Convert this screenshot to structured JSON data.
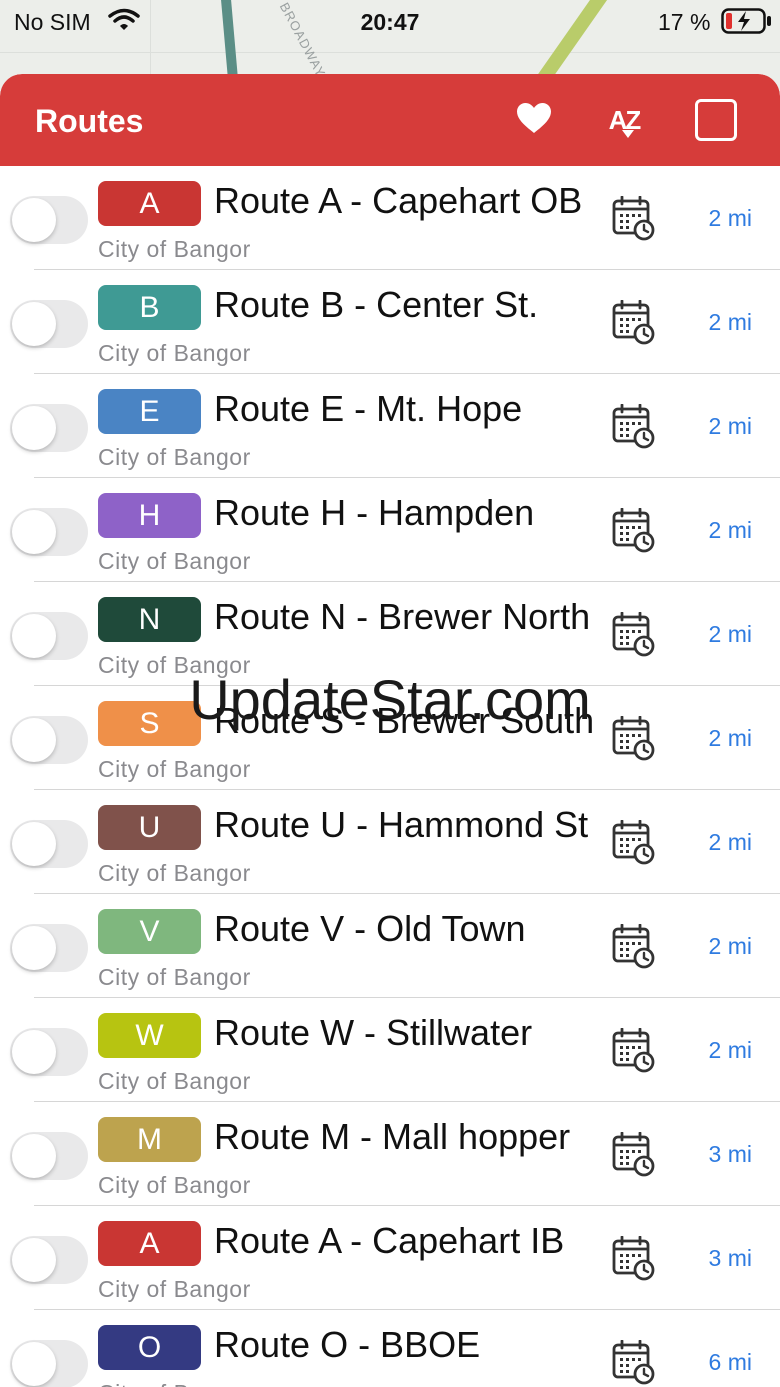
{
  "status_bar": {
    "carrier": "No SIM",
    "time": "20:47",
    "battery_percent": "17 %"
  },
  "map": {
    "street_label": "BROADWAY"
  },
  "header": {
    "title": "Routes",
    "favorites_icon": "heart-icon",
    "sort_icon": "sort-az-icon",
    "select_all_icon": "checkbox-icon"
  },
  "routes": [
    {
      "letter": "A",
      "color": "#c93633",
      "name": "Route A - Capehart OB",
      "agency": "City of Bangor",
      "distance": "2 mi"
    },
    {
      "letter": "B",
      "color": "#3f9a94",
      "name": "Route B - Center St.",
      "agency": "City of Bangor",
      "distance": "2 mi"
    },
    {
      "letter": "E",
      "color": "#4a84c4",
      "name": "Route E - Mt. Hope",
      "agency": "City of Bangor",
      "distance": "2 mi"
    },
    {
      "letter": "H",
      "color": "#8e62c8",
      "name": "Route H - Hampden",
      "agency": "City of Bangor",
      "distance": "2 mi"
    },
    {
      "letter": "N",
      "color": "#1f4a3a",
      "name": "Route N - Brewer North",
      "agency": "City of Bangor",
      "distance": "2 mi"
    },
    {
      "letter": "S",
      "color": "#ef9049",
      "name": "Route S - Brewer South",
      "agency": "City of Bangor",
      "distance": "2 mi"
    },
    {
      "letter": "U",
      "color": "#80524b",
      "name": "Route U - Hammond St",
      "agency": "City of Bangor",
      "distance": "2 mi"
    },
    {
      "letter": "V",
      "color": "#7fb77e",
      "name": "Route V - Old Town",
      "agency": "City of Bangor",
      "distance": "2 mi"
    },
    {
      "letter": "W",
      "color": "#b7c411",
      "name": "Route W - Stillwater",
      "agency": "City of Bangor",
      "distance": "2 mi"
    },
    {
      "letter": "M",
      "color": "#bda34e",
      "name": "Route M - Mall hopper",
      "agency": "City of Bangor",
      "distance": "3 mi"
    },
    {
      "letter": "A",
      "color": "#c93633",
      "name": "Route A - Capehart IB",
      "agency": "City of Bangor",
      "distance": "3 mi"
    },
    {
      "letter": "O",
      "color": "#343a82",
      "name": "Route O - BBOE",
      "agency": "City of Bangor",
      "distance": "6 mi"
    }
  ],
  "watermark": "UpdateStar.com"
}
